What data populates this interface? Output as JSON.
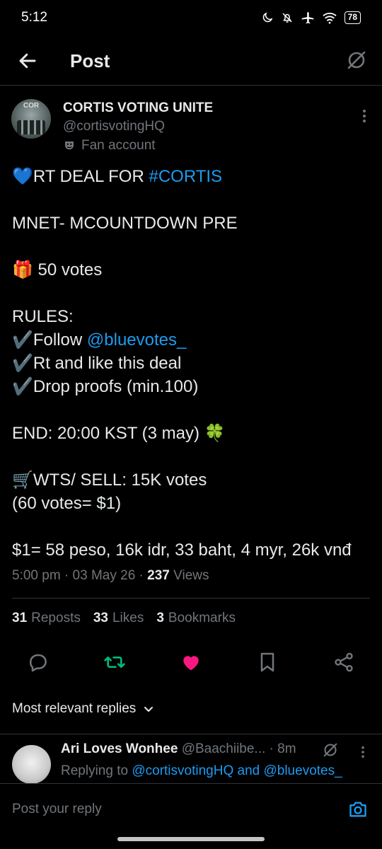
{
  "status_bar": {
    "time": "5:12",
    "battery": "78"
  },
  "header": {
    "title": "Post"
  },
  "post": {
    "author_name": "CORTIS VOTING UNITE",
    "author_handle": "@cortisvotingHQ",
    "account_label": "Fan account",
    "avatar_text": "COR",
    "lines": {
      "l1_prefix": "💙RT DEAL FOR ",
      "l1_tag": "#CORTIS",
      "l2": "MNET- MCOUNTDOWN PRE",
      "l3": "🎁 50 votes",
      "l4": "RULES:",
      "l5_prefix": "✔️Follow ",
      "l5_mention": "@bluevotes_",
      "l6": "✔️Rt and like this deal",
      "l7": "✔️Drop proofs (min.100)",
      "l8": "END:  20:00 KST (3 may) 🍀",
      "l9": "🛒WTS/ SELL:  15K votes",
      "l10": "(60 votes= $1)",
      "l11": "$1= 58 peso, 16k idr, 33 baht, 4 myr, 26k vnđ"
    },
    "timestamp": "5:00 pm · 03 May 26 · ",
    "views_count": "237",
    "views_label": " Views",
    "stats": {
      "reposts_count": "31",
      "reposts_label": "Reposts",
      "likes_count": "33",
      "likes_label": "Likes",
      "bookmarks_count": "3",
      "bookmarks_label": "Bookmarks"
    }
  },
  "icons": {
    "back": "arrow-left-icon",
    "grok": "grok-icon",
    "more": "more-vertical-icon",
    "reply": "reply-icon",
    "repost": "repost-icon",
    "like": "like-icon",
    "bookmark": "bookmark-icon",
    "share": "share-icon",
    "camera": "camera-icon",
    "fan": "mask-icon"
  },
  "colors": {
    "link": "#1d9bf0",
    "repost_active": "#00ba7c",
    "like_active": "#f91880",
    "background": "#000000"
  },
  "replies": {
    "sort_label": "Most relevant replies",
    "items": [
      {
        "name": "Ari Loves Wonhee",
        "handle": "@Baachiibe...",
        "time": " · 8m",
        "replying_prefix": "Replying to ",
        "replying_to": "@cortisvotingHQ and @bluevotes_"
      }
    ]
  },
  "composer": {
    "placeholder": "Post your reply"
  }
}
